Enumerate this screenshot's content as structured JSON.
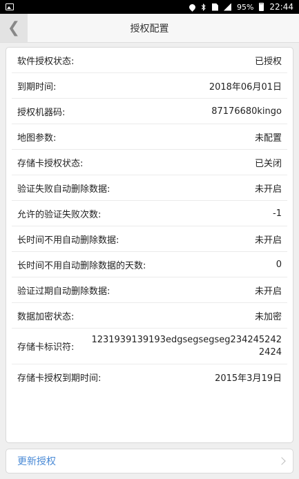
{
  "status_bar": {
    "battery_percent": "95%",
    "time": "22:44"
  },
  "header": {
    "back_glyph": "❮",
    "title": "授权配置"
  },
  "rows": [
    {
      "label": "软件授权状态:",
      "value": "已授权"
    },
    {
      "label": "到期时间:",
      "value": "2018年06月01日"
    },
    {
      "label": "授权机器码:",
      "value": "87176680kingo"
    },
    {
      "label": "地图参数:",
      "value": "未配置"
    },
    {
      "label": "存储卡授权状态:",
      "value": "已关闭"
    },
    {
      "label": "验证失败自动删除数据:",
      "value": "未开启"
    },
    {
      "label": "允许的验证失败次数:",
      "value": "-1"
    },
    {
      "label": "长时间不用自动删除数据:",
      "value": "未开启"
    },
    {
      "label": "长时间不用自动删除数据的天数:",
      "value": "0"
    },
    {
      "label": "验证过期自动删除数据:",
      "value": "未开启"
    },
    {
      "label": "数据加密状态:",
      "value": "未加密"
    },
    {
      "label": "存储卡标识符:",
      "value": "1231939139193edgsegsegseg2342452422424"
    },
    {
      "label": "存储卡授权到期时间:",
      "value": "2015年3月19日"
    }
  ],
  "footer": {
    "update_label": "更新授权"
  },
  "colors": {
    "accent": "#4a8ad6",
    "status_bar": "#000000",
    "background": "#efefef"
  }
}
